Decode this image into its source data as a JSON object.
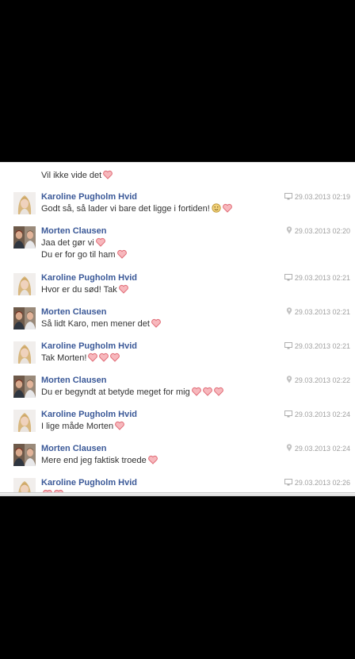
{
  "thread": {
    "first_line": "Vil ikke vide det",
    "messages": [
      {
        "sender": "Karoline Pugholm Hvid",
        "avatar": "karoline",
        "time": "29.03.2013 02:19",
        "source": "desktop",
        "lines": [
          {
            "text": "Godt så, så lader vi bare det ligge i fortiden!",
            "emotes": [
              "smiley",
              "heart"
            ]
          }
        ]
      },
      {
        "sender": "Morten Clausen",
        "avatar": "morten",
        "time": "29.03.2013 02:20",
        "source": "location",
        "lines": [
          {
            "text": "Jaa det gør vi",
            "emotes": [
              "heart"
            ]
          },
          {
            "text": "Du er for go til ham",
            "emotes": [
              "heart"
            ]
          }
        ]
      },
      {
        "sender": "Karoline Pugholm Hvid",
        "avatar": "karoline",
        "time": "29.03.2013 02:21",
        "source": "desktop",
        "lines": [
          {
            "text": "Hvor er du sød! Tak",
            "emotes": [
              "heart"
            ]
          }
        ]
      },
      {
        "sender": "Morten Clausen",
        "avatar": "morten",
        "time": "29.03.2013 02:21",
        "source": "location",
        "lines": [
          {
            "text": "Så lidt Karo, men mener det",
            "emotes": [
              "heart"
            ]
          }
        ]
      },
      {
        "sender": "Karoline Pugholm Hvid",
        "avatar": "karoline",
        "time": "29.03.2013 02:21",
        "source": "desktop",
        "lines": [
          {
            "text": "Tak Morten!",
            "emotes": [
              "heart",
              "heart",
              "heart"
            ]
          }
        ]
      },
      {
        "sender": "Morten Clausen",
        "avatar": "morten",
        "time": "29.03.2013 02:22",
        "source": "location",
        "lines": [
          {
            "text": "Du er begyndt at betyde meget for mig",
            "emotes": [
              "heart",
              "heart",
              "heart"
            ]
          }
        ]
      },
      {
        "sender": "Karoline Pugholm Hvid",
        "avatar": "karoline",
        "time": "29.03.2013 02:24",
        "source": "desktop",
        "lines": [
          {
            "text": " I lige måde Morten",
            "emotes": [
              "heart"
            ]
          }
        ]
      },
      {
        "sender": "Morten Clausen",
        "avatar": "morten",
        "time": "29.03.2013 02:24",
        "source": "location",
        "lines": [
          {
            "text": "Mere end jeg faktisk troede",
            "emotes": [
              "heart"
            ]
          }
        ]
      },
      {
        "sender": "Karoline Pugholm Hvid",
        "avatar": "karoline",
        "time": "29.03.2013 02:26",
        "source": "desktop",
        "lines": [
          {
            "text": "",
            "emotes": [
              "heart",
              "heart"
            ]
          }
        ]
      }
    ]
  },
  "colors": {
    "background": "#000000",
    "panel": "#ffffff",
    "name": "#3b5998",
    "text": "#333333",
    "timestamp": "#a0a0a0",
    "heart": "#e8707a"
  },
  "icons": {
    "heart": "heart-emoticon-icon",
    "smiley": "smiley-emoticon-icon",
    "desktop": "desktop-chat-icon",
    "location": "location-pin-icon"
  }
}
